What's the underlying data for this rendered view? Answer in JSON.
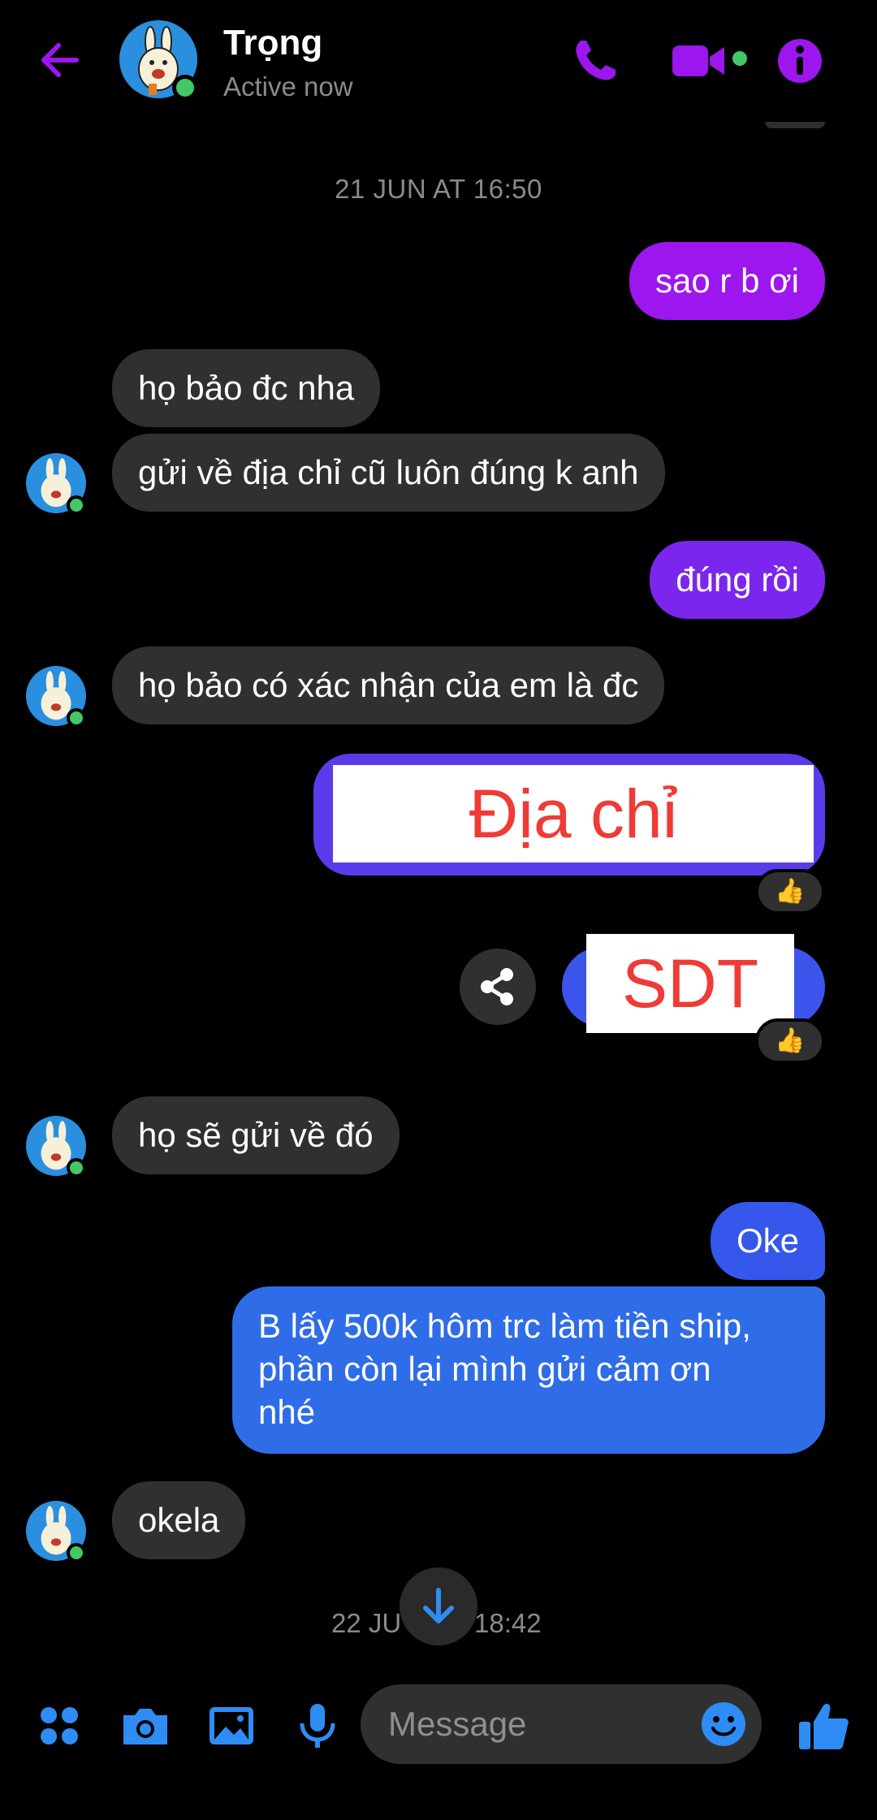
{
  "header": {
    "contact_name": "Trọng",
    "status": "Active now"
  },
  "conversation": {
    "timestamp_1": "21 JUN AT 16:50",
    "timestamp_2_left": "22 JU",
    "timestamp_2_right": "18:42",
    "messages": [
      {
        "from": "me",
        "text": "sao r b ơi"
      },
      {
        "from": "them",
        "text": "họ bảo đc nha"
      },
      {
        "from": "them",
        "text": "gửi về địa chỉ cũ luôn đúng k anh"
      },
      {
        "from": "me",
        "text": "đúng rồi"
      },
      {
        "from": "them",
        "text": "họ bảo có xác nhận của em là đc"
      },
      {
        "from": "me",
        "text": "Địa chỉ",
        "redacted": true,
        "reaction": "👍"
      },
      {
        "from": "me",
        "text": "SDT",
        "redacted": true,
        "reaction": "👍"
      },
      {
        "from": "them",
        "text": "họ sẽ gửi về đó"
      },
      {
        "from": "me",
        "text": "Oke"
      },
      {
        "from": "me",
        "lines": [
          "B lấy 500k hôm trc làm tiền ship,",
          "phần còn lại mình gửi cảm ơn",
          "nhé"
        ]
      },
      {
        "from": "them",
        "text": "okela"
      }
    ]
  },
  "composer": {
    "placeholder": "Message"
  },
  "colors": {
    "accent_purple": "#9c16ee",
    "accent_blue": "#2f6ce8",
    "incoming_bubble": "#303030",
    "online_green": "#44c767"
  },
  "icons": [
    "back-arrow-icon",
    "phone-icon",
    "video-camera-icon",
    "info-icon",
    "share-icon",
    "thumbs-up-icon",
    "arrow-down-icon",
    "apps-grid-icon",
    "camera-icon",
    "image-icon",
    "microphone-icon",
    "emoji-icon"
  ]
}
